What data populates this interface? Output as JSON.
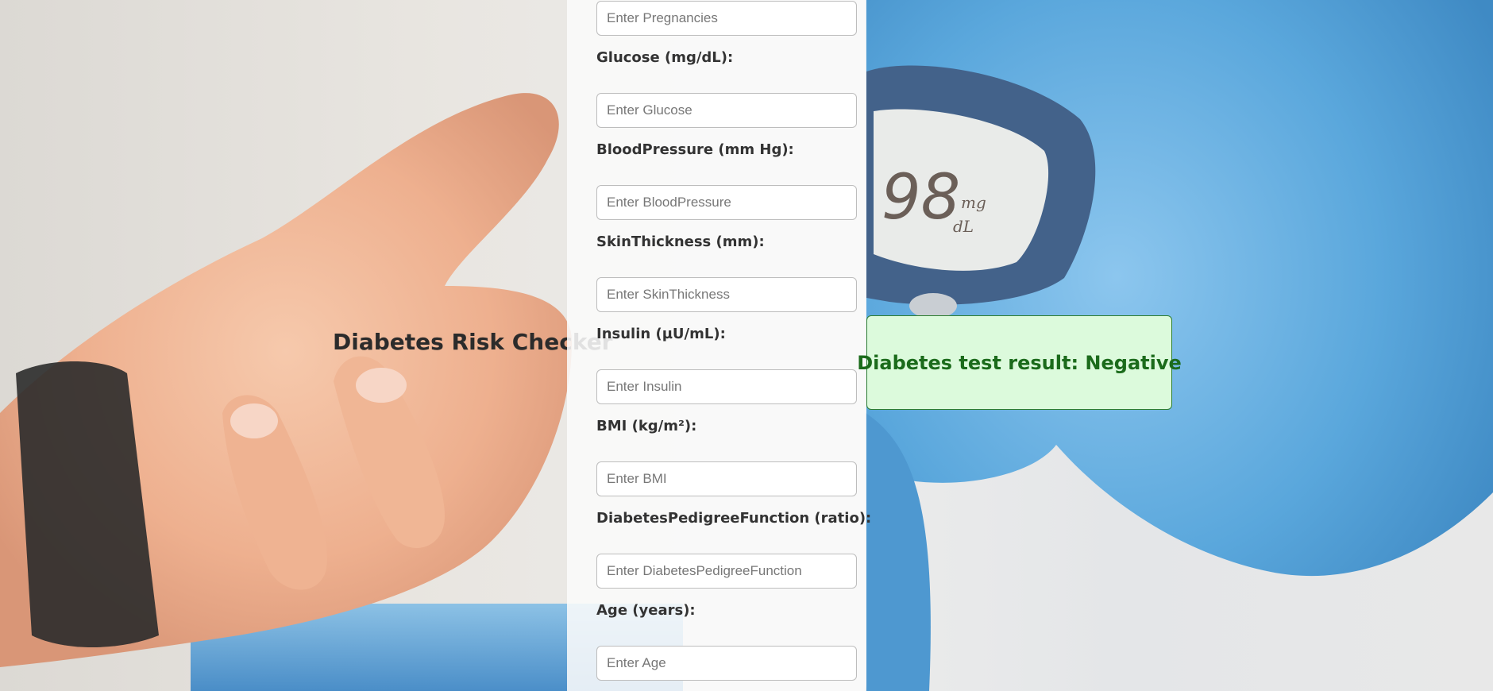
{
  "page": {
    "title": "Diabetes Risk Checker"
  },
  "form": {
    "fields": [
      {
        "label": "",
        "placeholder": "Enter Pregnancies",
        "value": ""
      },
      {
        "label": "Glucose (mg/dL):",
        "placeholder": "Enter Glucose",
        "value": ""
      },
      {
        "label": "BloodPressure (mm Hg):",
        "placeholder": "Enter BloodPressure",
        "value": ""
      },
      {
        "label": "SkinThickness (mm):",
        "placeholder": "Enter SkinThickness",
        "value": ""
      },
      {
        "label": "Insulin (µU/mL):",
        "placeholder": "Enter Insulin",
        "value": ""
      },
      {
        "label": "BMI (kg/m²):",
        "placeholder": "Enter BMI",
        "value": ""
      },
      {
        "label": "DiabetesPedigreeFunction (ratio):",
        "placeholder": "Enter DiabetesPedigreeFunction",
        "value": ""
      },
      {
        "label": "Age (years):",
        "placeholder": "Enter Age",
        "value": ""
      }
    ]
  },
  "result": {
    "text": "Diabetes test result: Negative",
    "status": "negative"
  },
  "background": {
    "meter_reading": "98",
    "meter_unit_top": "mg",
    "meter_unit_bottom": "dL"
  },
  "colors": {
    "result_bg": "#dcfadc",
    "result_border": "#2e7d32",
    "result_text": "#1b6b1b",
    "glove": "#5aa7dc"
  }
}
